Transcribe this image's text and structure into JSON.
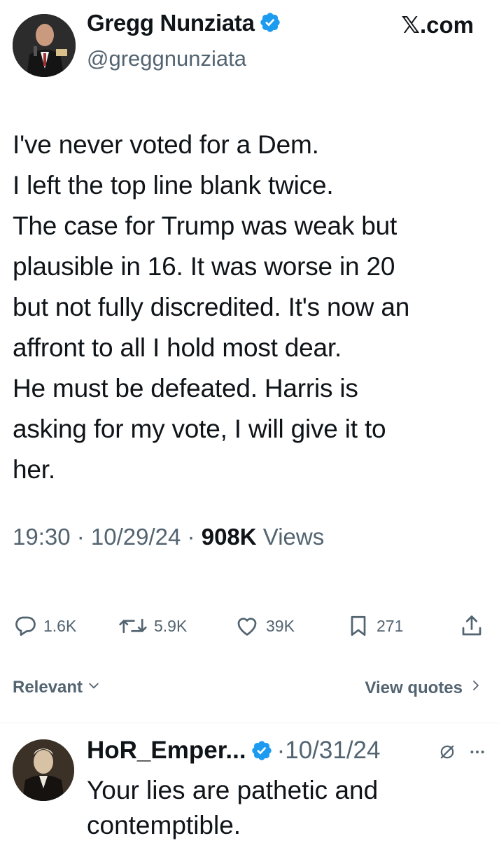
{
  "tweet": {
    "author_name": "Gregg Nunziata",
    "handle": "@greggnunziata",
    "source": "𝕏.com",
    "lines": [
      "I've never voted for a Dem.",
      "I left the top line blank twice.",
      "The case for Trump was weak but",
      "plausible in 16. It was worse in 20",
      "but not fully discredited. It's now an",
      "affront to all I hold most dear.",
      "He must be defeated. Harris is",
      "asking for my vote, I will give it to",
      "her."
    ],
    "time": "19:30",
    "date": "10/29/24",
    "views_count": "908K",
    "views_label": "Views",
    "sep": " · "
  },
  "actions": {
    "replies": "1.6K",
    "reposts": "5.9K",
    "likes": "39K",
    "bookmarks": "271"
  },
  "replies_bar": {
    "filter_label": "Relevant",
    "view_quotes_label": "View quotes"
  },
  "reply": {
    "author_name": "HoR_Emper...",
    "date": "10/31/24",
    "sep": "·",
    "lines": [
      "Your lies are pathetic and",
      "contemptible."
    ]
  },
  "colors": {
    "verified_blue": "#1d9bf0",
    "text": "#0f1419",
    "secondary": "#536471"
  },
  "icons": [
    "verified-badge-icon",
    "reply-icon",
    "repost-icon",
    "like-icon",
    "bookmark-icon",
    "share-icon",
    "chevron-down-icon",
    "chevron-right-icon",
    "grok-icon",
    "more-icon"
  ]
}
